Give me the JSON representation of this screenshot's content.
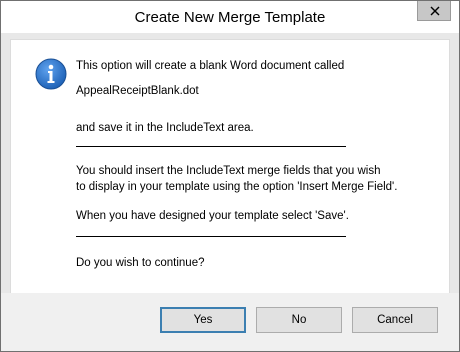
{
  "dialog": {
    "title": "Create New Merge Template",
    "close_glyph": "✕"
  },
  "message": {
    "icon": "information-icon",
    "line1": "This option will create a blank Word document called",
    "filename": "AppealReceiptBlank.dot",
    "line3": "and save it in the IncludeText area.",
    "line4a": "You should insert the IncludeText merge fields that you wish",
    "line4b": "to display in your template using the option 'Insert Merge Field'.",
    "line5": "When you have designed your template select 'Save'.",
    "question": "Do you wish to continue?"
  },
  "buttons": {
    "yes": "Yes",
    "no": "No",
    "cancel": "Cancel"
  },
  "colors": {
    "icon_blue": "#1f63b8",
    "default_button_border": "#3c7fb1"
  }
}
